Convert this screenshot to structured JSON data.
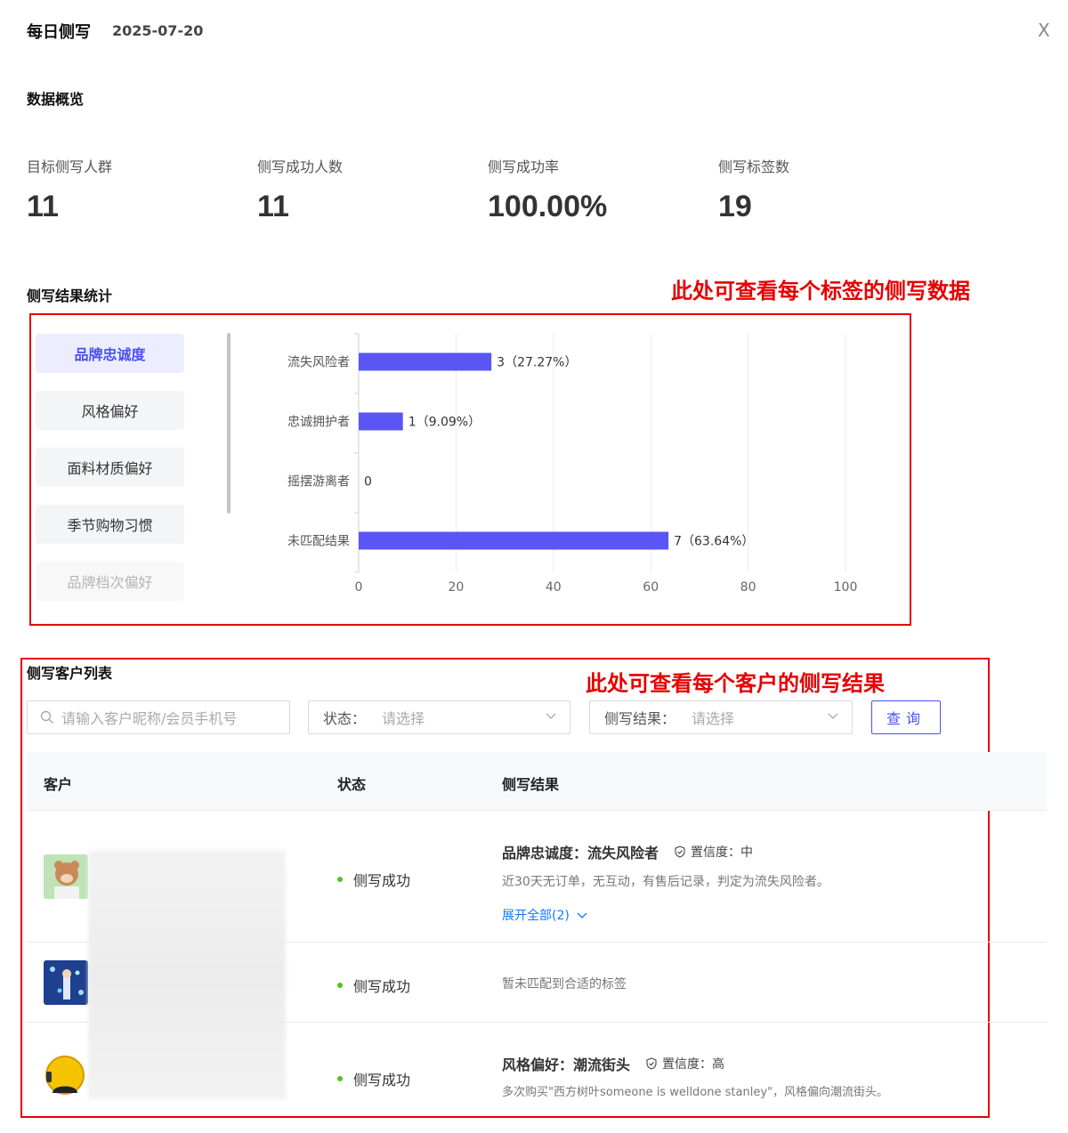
{
  "header": {
    "title": "每日侧写",
    "date": "2025-07-20",
    "close": "X"
  },
  "overview": {
    "title": "数据概览",
    "stats": [
      {
        "label": "目标侧写人群",
        "value": "11"
      },
      {
        "label": "侧写成功人数",
        "value": "11"
      },
      {
        "label": "侧写成功率",
        "value": "100.00%"
      },
      {
        "label": "侧写标签数",
        "value": "19"
      }
    ]
  },
  "results": {
    "title": "侧写结果统计",
    "annotation": "此处可查看每个标签的侧写数据",
    "tabs": [
      "品牌忠诚度",
      "风格偏好",
      "面料材质偏好",
      "季节购物习惯",
      "品牌档次偏好"
    ],
    "active_tab": 0
  },
  "chart_data": {
    "type": "bar",
    "orientation": "horizontal",
    "categories": [
      "流失风险者",
      "忠诚拥护者",
      "摇摆游离者",
      "未匹配结果"
    ],
    "values": [
      3,
      1,
      0,
      7
    ],
    "data_labels": [
      "3（27.27%）",
      "1（9.09%）",
      "0",
      "7（63.64%）"
    ],
    "percent_values": [
      27.27,
      9.09,
      0,
      63.64
    ],
    "xlim": [
      0,
      100
    ],
    "xticks": [
      "0",
      "20",
      "40",
      "60",
      "80",
      "100"
    ],
    "grid": true,
    "bar_color": "#5a55f5"
  },
  "customers": {
    "title": "侧写客户列表",
    "annotation": "此处可查看每个客户的侧写结果",
    "search_placeholder": "请输入客户昵称/会员手机号",
    "status_filter": {
      "label": "状态：",
      "placeholder": "请选择"
    },
    "result_filter": {
      "label": "侧写结果：",
      "placeholder": "请选择"
    },
    "query_button": "查询",
    "columns": [
      "客户",
      "状态",
      "侧写结果"
    ],
    "rows": [
      {
        "status": "侧写成功",
        "result_title": "品牌忠诚度：流失风险者",
        "confidence": "置信度：中",
        "description": "近30天无订单，无互动，有售后记录，判定为流失风险者。",
        "expand": "展开全部(2)"
      },
      {
        "status": "侧写成功",
        "result_title": "",
        "confidence": "",
        "description": "暂未匹配到合适的标签",
        "expand": ""
      },
      {
        "status": "侧写成功",
        "result_title": "风格偏好：潮流街头",
        "confidence": "置信度：高",
        "description": "多次购买\"西方树叶someone is welldone stanley\"，风格偏向潮流街头。",
        "expand": ""
      }
    ]
  },
  "colors": {
    "accent": "#4b4ff5",
    "annotation": "#e60000",
    "success": "#52c41a",
    "link": "#1677ff"
  }
}
